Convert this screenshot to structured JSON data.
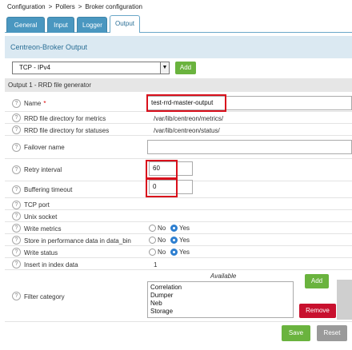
{
  "breadcrumb": [
    "Configuration",
    "Pollers",
    "Broker configuration"
  ],
  "breadcrumb_sep": ">",
  "tabs": [
    "General",
    "Input",
    "Logger",
    "Output"
  ],
  "section_title": "Centreon-Broker Output",
  "output_type": {
    "selected": "TCP - IPv4",
    "add_label": "Add"
  },
  "output_header": "Output 1 - RRD file generator",
  "fields": {
    "name": {
      "label": "Name",
      "required_mark": "*",
      "value": "test-rrd-master-output"
    },
    "metrics_dir": {
      "label": "RRD file directory for metrics",
      "value": "/var/lib/centreon/metrics/"
    },
    "status_dir": {
      "label": "RRD file directory for statuses",
      "value": "/var/lib/centreon/status/"
    },
    "failover": {
      "label": "Failover name",
      "value": ""
    },
    "retry": {
      "label": "Retry interval",
      "value": "60"
    },
    "buffering": {
      "label": "Buffering timeout",
      "value": "0"
    },
    "tcp_port": {
      "label": "TCP port"
    },
    "unix_socket": {
      "label": "Unix socket"
    },
    "write_metrics": {
      "label": "Write metrics",
      "selected": "Yes"
    },
    "store_perf": {
      "label": "Store in performance data in data_bin",
      "selected": "Yes"
    },
    "write_status": {
      "label": "Write status",
      "selected": "Yes"
    },
    "insert_index": {
      "label": "Insert in index data",
      "value": "1"
    },
    "filter_category": {
      "label": "Filter category",
      "available_label": "Available",
      "options": [
        "Correlation",
        "Dumper",
        "Neb",
        "Storage"
      ],
      "add_label": "Add",
      "remove_label": "Remove"
    }
  },
  "radio_labels": {
    "no": "No",
    "yes": "Yes"
  },
  "help_glyph": "?",
  "footer": {
    "save_label": "Save",
    "reset_label": "Reset"
  },
  "colors": {
    "tab": "#4a97c0",
    "add": "#6ab33e",
    "remove": "#c8102e",
    "reset": "#9a9a9a",
    "highlight": "#d9101c"
  }
}
